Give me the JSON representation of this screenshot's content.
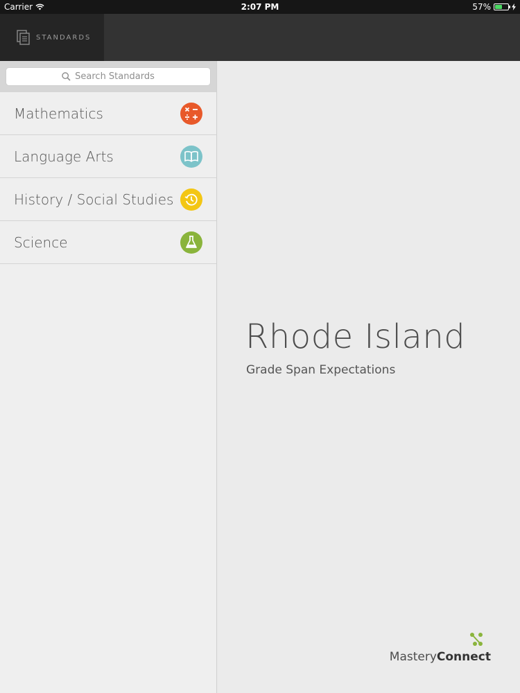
{
  "status_bar": {
    "carrier": "Carrier",
    "time": "2:07 PM",
    "battery": "57%",
    "battery_level": 0.57
  },
  "nav": {
    "tab_label": "STANDARDS"
  },
  "search": {
    "placeholder": "Search Standards"
  },
  "subjects": [
    {
      "label": "Mathematics",
      "icon": "math-operators-icon",
      "color": "#e8592a"
    },
    {
      "label": "Language Arts",
      "icon": "open-book-icon",
      "color": "#7cc3c9"
    },
    {
      "label": "History / Social Studies",
      "icon": "history-clock-icon",
      "color": "#f3c614"
    },
    {
      "label": "Science",
      "icon": "flask-icon",
      "color": "#8ab43c"
    }
  ],
  "main": {
    "title": "Rhode Island",
    "subtitle": "Grade Span Expectations"
  },
  "brand": {
    "name_light": "Mastery",
    "name_bold": "Connect",
    "accent": "#8ab43c"
  }
}
